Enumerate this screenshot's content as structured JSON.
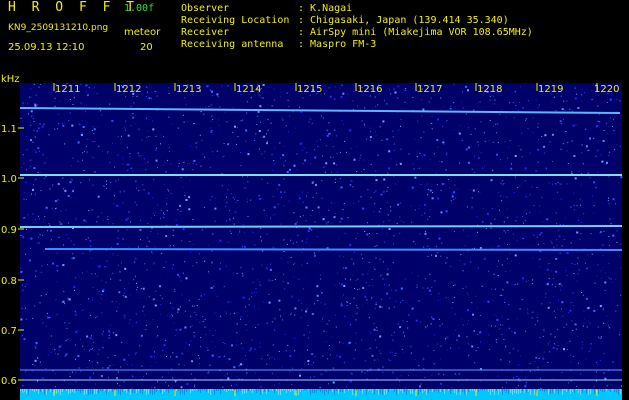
{
  "app": {
    "title": "H R O F F T",
    "version": "1.00f",
    "filename": "KN9_2509131210.png",
    "mode": "meteor",
    "datetime": "25.09.13 12:10",
    "count": "20"
  },
  "info": {
    "labels": [
      "Observer",
      "Receiving Location",
      "Receiver",
      "Receiving antenna"
    ],
    "values": [
      ": K.Nagai",
      ": Chigasaki, Japan (139.414 35.340)",
      ": AirSpy mini (Miakejima VOR 108.65MHz)",
      ": Maspro FM-3"
    ]
  },
  "axis": {
    "unit": "kHz",
    "y_labels": [
      "1.1",
      "1.0",
      "0.9",
      "0.8",
      "0.7",
      "0.6"
    ],
    "x_labels": [
      "1211",
      "1212",
      "1213",
      "1214",
      "1215",
      "1216",
      "1217",
      "1218",
      "1219",
      "1220"
    ]
  },
  "colors": {
    "background": "#000000",
    "plot": "#00006b",
    "label_yellow": "#f0f000",
    "label_green": "#22e622",
    "signal": "#60d8ff",
    "bottom_band": "#00c8ff"
  }
}
